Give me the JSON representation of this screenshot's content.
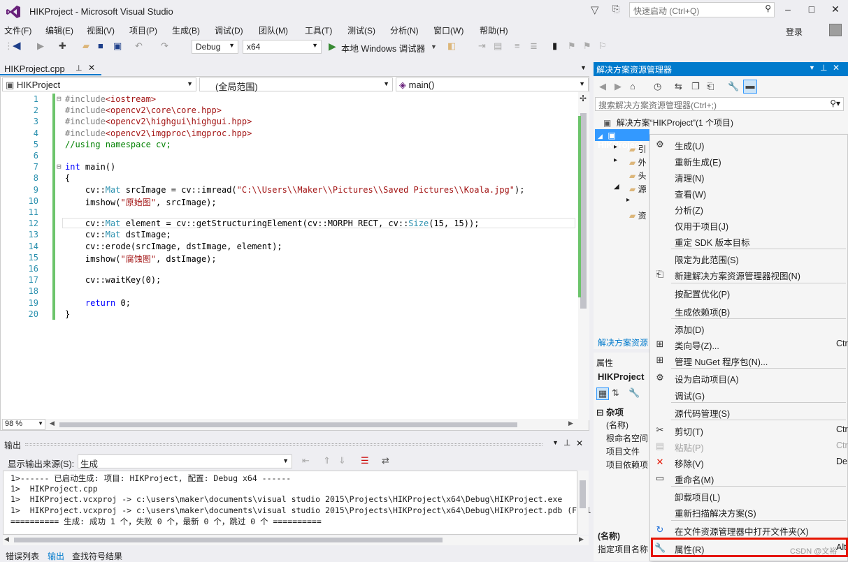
{
  "window": {
    "title": "HIKProject - Microsoft Visual Studio",
    "quick_launch_placeholder": "快速启动 (Ctrl+Q)",
    "login": "登录",
    "minimize": "–",
    "maximize": "□",
    "close": "✕"
  },
  "menubar": [
    "文件(F)",
    "编辑(E)",
    "视图(V)",
    "项目(P)",
    "生成(B)",
    "调试(D)",
    "团队(M)",
    "工具(T)",
    "测试(S)",
    "分析(N)",
    "窗口(W)",
    "帮助(H)"
  ],
  "toolbar": {
    "config": "Debug",
    "platform": "x64",
    "run_label": "本地 Windows 调试器"
  },
  "editor": {
    "tab_name": "HIKProject.cpp",
    "nav_project": "HIKProject",
    "nav_scope": "(全局范围)",
    "nav_member": "main()",
    "zoom": "98 %",
    "lines": [
      "#include<iostream>",
      "#include<opencv2\\core\\core.hpp>",
      "#include<opencv2\\highgui\\highgui.hpp>",
      "#include<opencv2\\imgproc\\imgproc.hpp>",
      "//using namespace cv;",
      "",
      "int main()",
      "{",
      "    cv::Mat srcImage = cv::imread(\"C:\\\\Users\\\\Maker\\\\Pictures\\\\Saved Pictures\\\\Koala.jpg\");",
      "    imshow(\"原始图\", srcImage);",
      "",
      "    cv::Mat element = cv::getStructuringElement(cv::MORPH_RECT, cv::Size(15, 15));",
      "    cv::Mat dstImage;",
      "    cv::erode(srcImage, dstImage, element);",
      "    imshow(\"腐蚀图\", dstImage);",
      "",
      "    cv::waitKey(0);",
      "",
      "    return 0;",
      "}"
    ]
  },
  "output": {
    "title": "输出",
    "source_label": "显示输出来源(S):",
    "source_value": "生成",
    "lines": [
      "1>------ 已启动生成: 项目: HIKProject, 配置: Debug x64 ------",
      "1>  HIKProject.cpp",
      "1>  HIKProject.vcxproj -> c:\\users\\maker\\documents\\visual studio 2015\\Projects\\HIKProject\\x64\\Debug\\HIKProject.exe",
      "1>  HIKProject.vcxproj -> c:\\users\\maker\\documents\\visual studio 2015\\Projects\\HIKProject\\x64\\Debug\\HIKProject.pdb (Full PD",
      "========== 生成: 成功 1 个，失败 0 个，最新 0 个，跳过 0 个 =========="
    ],
    "bottom_tabs": [
      "错误列表",
      "输出",
      "查找符号结果"
    ]
  },
  "solution_explorer": {
    "title": "解决方案资源管理器",
    "search_placeholder": "搜索解决方案资源管理器(Ctrl+;)",
    "solution_label": "解决方案“HIKProject”(1 个项目)",
    "project_label": "HIKProject",
    "tree_stubs": [
      "引",
      "外",
      "头",
      "源",
      "资"
    ],
    "bottom_link": "解决方案资源"
  },
  "properties": {
    "title": "属性",
    "object": "HIKProject",
    "category": "杂项",
    "rows": [
      "(名称)",
      "根命名空间",
      "项目文件",
      "项目依赖项"
    ],
    "desc_title": "(名称)",
    "desc_text": "指定项目名称"
  },
  "context_menu": {
    "items": [
      {
        "label": "生成(U)",
        "icon": "build-icon"
      },
      {
        "label": "重新生成(E)"
      },
      {
        "label": "清理(N)"
      },
      {
        "label": "查看(W)"
      },
      {
        "label": "分析(Z)"
      },
      {
        "label": "仅用于项目(J)"
      },
      {
        "label": "重定 SDK 版本目标"
      },
      {
        "label": "限定为此范围(S)"
      },
      {
        "label": "新建解决方案资源管理器视图(N)",
        "icon": "new-view-icon"
      },
      {
        "label": "按配置优化(P)"
      },
      {
        "label": "生成依赖项(B)"
      },
      {
        "label": "添加(D)"
      },
      {
        "label": "类向导(Z)...",
        "shortcut": "Ctr",
        "icon": "class-wizard-icon"
      },
      {
        "label": "管理 NuGet 程序包(N)...",
        "icon": "nuget-icon"
      },
      {
        "label": "设为启动项目(A)",
        "icon": "gear-icon"
      },
      {
        "label": "调试(G)"
      },
      {
        "label": "源代码管理(S)"
      },
      {
        "label": "剪切(T)",
        "shortcut": "Ctr",
        "icon": "scissors-icon"
      },
      {
        "label": "粘贴(P)",
        "shortcut": "Ctr",
        "icon": "paste-icon",
        "disabled": true
      },
      {
        "label": "移除(V)",
        "shortcut": "De",
        "icon": "remove-icon"
      },
      {
        "label": "重命名(M)",
        "icon": "rename-icon"
      },
      {
        "label": "卸载项目(L)"
      },
      {
        "label": "重新扫描解决方案(S)"
      },
      {
        "label": "在文件资源管理器中打开文件夹(X)",
        "icon": "open-folder-icon"
      },
      {
        "label": "属性(R)",
        "shortcut": "Alt",
        "icon": "wrench-icon"
      }
    ]
  },
  "watermark": "CSDN @文裕",
  "colors": {
    "accent": "#007acc",
    "green_margin": "#6cc46b",
    "highlight_border": "#e51400"
  }
}
